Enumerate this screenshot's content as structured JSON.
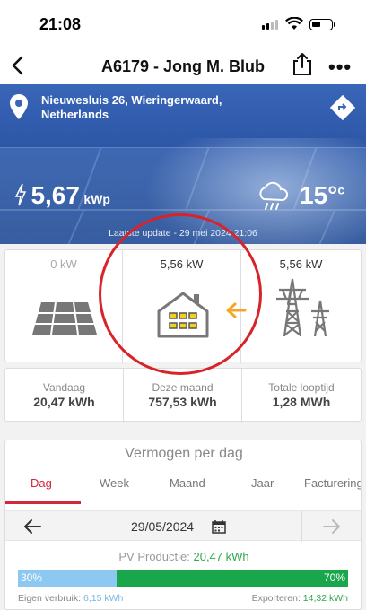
{
  "status_bar": {
    "time": "21:08"
  },
  "nav": {
    "title": "A6179 - Jong M. Blub"
  },
  "hero": {
    "address_line1": "Nieuwesluis 26, Wieringerwaard,",
    "address_line2": "Netherlands",
    "capacity_value": "5,67",
    "capacity_unit": "kWp",
    "temperature_value": "15°",
    "temperature_unit": "c",
    "last_update": "Laatste update - 29 mei 2024 21:06"
  },
  "flow": {
    "solar_value": "0 kW",
    "home_value": "5,56 kW",
    "grid_value": "5,56 kW",
    "colors": {
      "arrow": "#f5a623",
      "icon": "#777777"
    }
  },
  "stats": {
    "today_label": "Vandaag",
    "today_value": "20,47 kWh",
    "month_label": "Deze maand",
    "month_value": "757,53 kWh",
    "total_label": "Totale looptijd",
    "total_value": "1,28 MWh"
  },
  "power": {
    "title": "Vermogen per dag",
    "tabs": [
      "Dag",
      "Week",
      "Maand",
      "Jaar",
      "Facturering"
    ],
    "active_tab": "Dag",
    "date": "29/05/2024",
    "pv_label": "PV Productie:",
    "pv_value": "20,47 kWh",
    "own_percent_label": "30%",
    "export_percent_label": "70%",
    "own_fraction": 0.3,
    "own_label": "Eigen verbruik:",
    "own_value": "6,15 kWh",
    "export_label": "Exporteren:",
    "export_value": "14,32 kWh",
    "colors": {
      "own": "#8cc8f0",
      "export": "#1aa64a",
      "accent": "#d0283a"
    }
  }
}
